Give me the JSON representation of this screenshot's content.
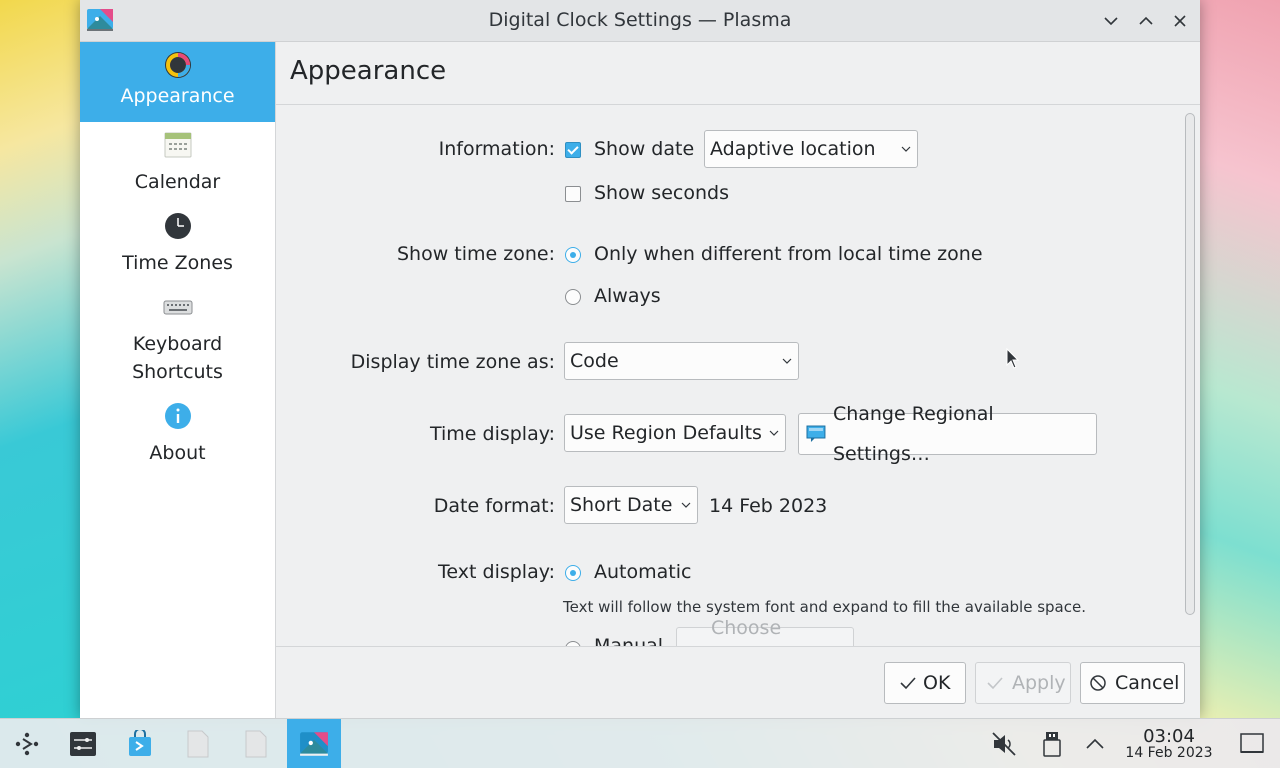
{
  "window": {
    "title": "Digital Clock Settings — Plasma"
  },
  "sidebar": {
    "items": [
      {
        "label": "Appearance",
        "icon": "color-wheel-icon",
        "active": true
      },
      {
        "label": "Calendar",
        "icon": "calendar-icon",
        "active": false
      },
      {
        "label": "Time Zones",
        "icon": "clock-icon",
        "active": false
      },
      {
        "label": "Keyboard",
        "label2": "Shortcuts",
        "icon": "keyboard-icon",
        "active": false
      },
      {
        "label": "About",
        "icon": "info-icon",
        "active": false
      }
    ]
  },
  "page": {
    "title": "Appearance"
  },
  "form": {
    "information": {
      "label": "Information:",
      "show_date": {
        "label": "Show date",
        "checked": true
      },
      "date_location": "Adaptive location",
      "show_seconds": {
        "label": "Show seconds",
        "checked": false
      }
    },
    "show_time_zone": {
      "label": "Show time zone:",
      "options": [
        {
          "label": "Only when different from local time zone",
          "checked": true
        },
        {
          "label": "Always",
          "checked": false
        }
      ]
    },
    "display_time_zone_as": {
      "label": "Display time zone as:",
      "value": "Code"
    },
    "time_display": {
      "label": "Time display:",
      "value": "Use Region Defaults",
      "change_button": "Change Regional Settings…"
    },
    "date_format": {
      "label": "Date format:",
      "value": "Short Date",
      "preview": "14 Feb 2023"
    },
    "text_display": {
      "label": "Text display:",
      "automatic": {
        "label": "Automatic",
        "checked": true
      },
      "hint": "Text will follow the system font and expand to fill the available space.",
      "manual": {
        "label": "Manual",
        "checked": false
      },
      "choose_style": "Choose Style…"
    }
  },
  "buttons": {
    "ok": "OK",
    "apply": "Apply",
    "cancel": "Cancel"
  },
  "taskbar": {
    "clock_time": "03:04",
    "clock_date": "14 Feb 2023"
  },
  "colors": {
    "accent": "#3daee9",
    "window_bg": "#eff0f1"
  }
}
